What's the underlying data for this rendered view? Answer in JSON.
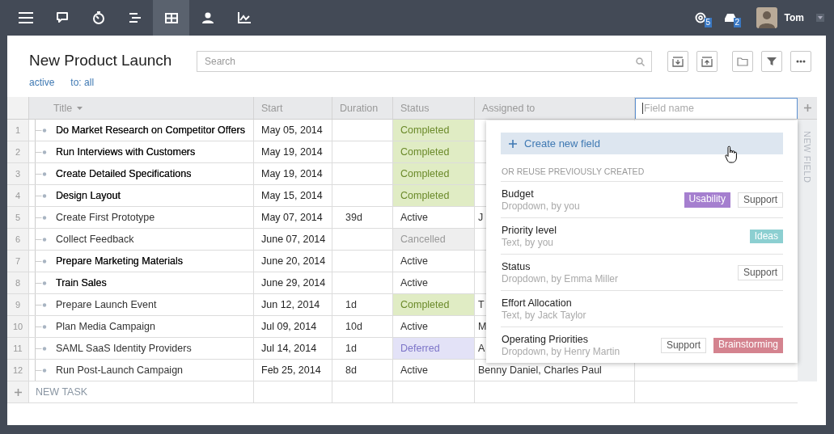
{
  "nav_tabs": [
    {
      "selected": false
    },
    {
      "selected": false
    },
    {
      "selected": false
    },
    {
      "selected": false
    },
    {
      "selected": true
    },
    {
      "selected": false
    },
    {
      "selected": false
    }
  ],
  "notifications": [
    {
      "count": "5"
    },
    {
      "count": "2"
    }
  ],
  "user": {
    "name": "Tom"
  },
  "project": {
    "title": "New Product Launch",
    "filters": [
      "active",
      "to: all"
    ],
    "search": {
      "placeholder": "Search"
    }
  },
  "table": {
    "columns": [
      {
        "label": "Title",
        "sorted": true
      },
      {
        "label": "Start",
        "sorted": false
      },
      {
        "label": "Duration",
        "sorted": false
      },
      {
        "label": "Status",
        "sorted": false
      },
      {
        "label": "Assigned to",
        "sorted": false
      }
    ],
    "field_input": {
      "placeholder": "Field name"
    },
    "new_field_label": "NEW FIELD",
    "rows": [
      {
        "number": "1",
        "title": "Do Market Research on Competitor Offers",
        "bold": true,
        "start": "May 05, 2014",
        "status": {
          "text": "Completed",
          "kind": "completed"
        }
      },
      {
        "number": "2",
        "title": "Run Interviews with Customers",
        "bold": true,
        "start": "May 19, 2014",
        "status": {
          "text": "Completed",
          "kind": "completed"
        }
      },
      {
        "number": "3",
        "title": "Create Detailed Specifications",
        "bold": true,
        "start": "May 19, 2014",
        "status": {
          "text": "Completed",
          "kind": "completed"
        }
      },
      {
        "number": "4",
        "title": "Design Layout",
        "bold": true,
        "start": "May 15, 2014",
        "status": {
          "text": "Completed",
          "kind": "completed"
        }
      },
      {
        "number": "5",
        "title": "Create First Prototype",
        "bold": false,
        "start": "May 07, 2014",
        "duration": "39d",
        "status": {
          "text": "Active",
          "kind": "active"
        },
        "assigned": "J"
      },
      {
        "number": "6",
        "title": "Collect Feedback",
        "bold": false,
        "start": "June 07, 2014",
        "status": {
          "text": "Cancelled",
          "kind": "cancelled"
        }
      },
      {
        "number": "7",
        "title": "Prepare Marketing Materials",
        "bold": true,
        "start": "June 20, 2014",
        "status": {
          "text": "Active",
          "kind": "active"
        }
      },
      {
        "number": "8",
        "title": "Train Sales",
        "bold": true,
        "start": "June 29, 2014",
        "status": {
          "text": "Active",
          "kind": "active"
        }
      },
      {
        "number": "9",
        "title": "Prepare Launch Event",
        "bold": false,
        "start": "Jun 12, 2014",
        "duration": "1d",
        "status": {
          "text": "Completed",
          "kind": "completed"
        },
        "assigned": "T"
      },
      {
        "number": "10",
        "title": "Plan Media Campaign",
        "bold": false,
        "start": "Jul 09, 2014",
        "duration": "10d",
        "status": {
          "text": "Active",
          "kind": "active"
        },
        "assigned": "M"
      },
      {
        "number": "11",
        "title": "SAML SaaS Identity Providers",
        "bold": false,
        "start": "Jul 14, 2014",
        "duration": "1d",
        "status": {
          "text": "Deferred",
          "kind": "deferred"
        },
        "assigned": "A"
      },
      {
        "number": "12",
        "title": "Run Post-Launch Campaign",
        "bold": false,
        "start": "Feb 25, 2014",
        "duration": "8d",
        "status": {
          "text": "Active",
          "kind": "active"
        },
        "assigned": "Benny Daniel, Charles Paul"
      }
    ],
    "new_task": {
      "label": "NEW TASK"
    }
  },
  "field_menu": {
    "create_button": "Create new field",
    "section_label": "OR REUSE PREVIOUSLY CREATED",
    "fields": [
      {
        "name": "Budget",
        "meta": "Dropdown, by you",
        "tags": [
          {
            "label": "Usability",
            "kind": "filled",
            "color": "#a57fcf"
          },
          {
            "label": "Support",
            "kind": "outline"
          }
        ]
      },
      {
        "name": "Priority level",
        "meta": "Text, by you",
        "tags": [
          {
            "label": "Ideas",
            "kind": "filled",
            "color": "#8ccfd1"
          }
        ]
      },
      {
        "name": "Status",
        "meta": "Dropdown, by Emma Miller",
        "tags": [
          {
            "label": "Support",
            "kind": "outline"
          }
        ]
      },
      {
        "name": "Effort Allocation",
        "meta": "Text, by Jack Taylor"
      },
      {
        "name": "Operating Priorities",
        "meta": "Dropdown, by Henry Martin",
        "tags": [
          {
            "label": "Support",
            "kind": "outline"
          },
          {
            "label": "Brainstorming",
            "kind": "filled",
            "color": "#d4838f"
          }
        ]
      }
    ]
  }
}
